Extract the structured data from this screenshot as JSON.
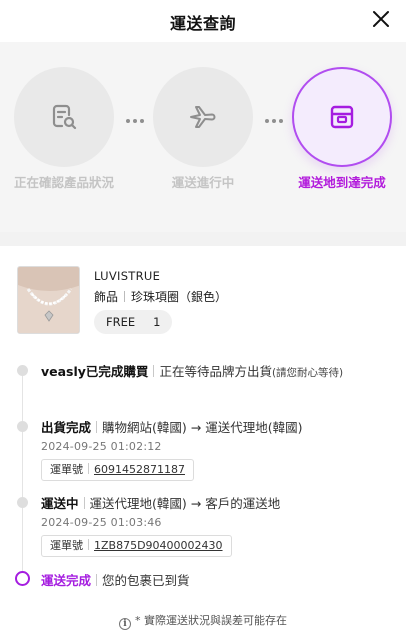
{
  "header": {
    "title": "運送查詢"
  },
  "steps": [
    {
      "label": "正在確認產品狀況",
      "icon": "document-search-icon",
      "active": false
    },
    {
      "label": "運送進行中",
      "icon": "airplane-icon",
      "active": false
    },
    {
      "label": "運送地到達完成",
      "icon": "package-box-icon",
      "active": true
    }
  ],
  "colors": {
    "accent": "#a51de0",
    "inactive_text": "#c4c4c4"
  },
  "product": {
    "brand": "LUVISTRUE",
    "category": "飾品",
    "name": "珍珠項圈（銀色）",
    "option_size": "FREE",
    "quantity": "1"
  },
  "timeline": [
    {
      "title": "veasly已完成購買",
      "desc": "正在等待品牌方出貨",
      "note": "(請您耐心等待)"
    },
    {
      "title": "出貨完成",
      "desc": "購物網站(韓國) → 運送代理地(韓國)",
      "time": "2024-09-25 01:02:12",
      "waybill_label": "運單號",
      "waybill_no": "6091452871187"
    },
    {
      "title": "運送中",
      "desc": "運送代理地(韓國) → 客戶的運送地",
      "time": "2024-09-25 01:03:46",
      "waybill_label": "運單號",
      "waybill_no": "1ZB875D90400002430"
    },
    {
      "title": "運送完成",
      "desc": "您的包裹已到貨"
    }
  ],
  "footer": {
    "note": "* 實際運送狀況與誤差可能存在"
  }
}
